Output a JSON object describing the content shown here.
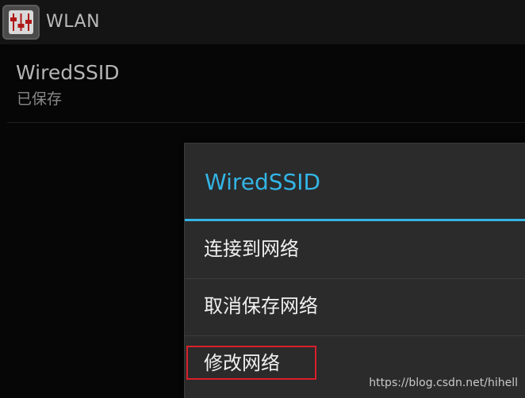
{
  "action_bar": {
    "icon": "settings-sliders-icon",
    "title": "WLAN"
  },
  "network": {
    "ssid": "WiredSSID",
    "status": "已保存"
  },
  "dialog": {
    "title": "WiredSSID",
    "accent_color": "#33b5e5",
    "options": [
      {
        "label": "连接到网络"
      },
      {
        "label": "取消保存网络"
      },
      {
        "label": "修改网络",
        "highlighted": true
      }
    ],
    "highlight_color": "#d9202a"
  },
  "watermark": "https://blog.csdn.net/hihell"
}
